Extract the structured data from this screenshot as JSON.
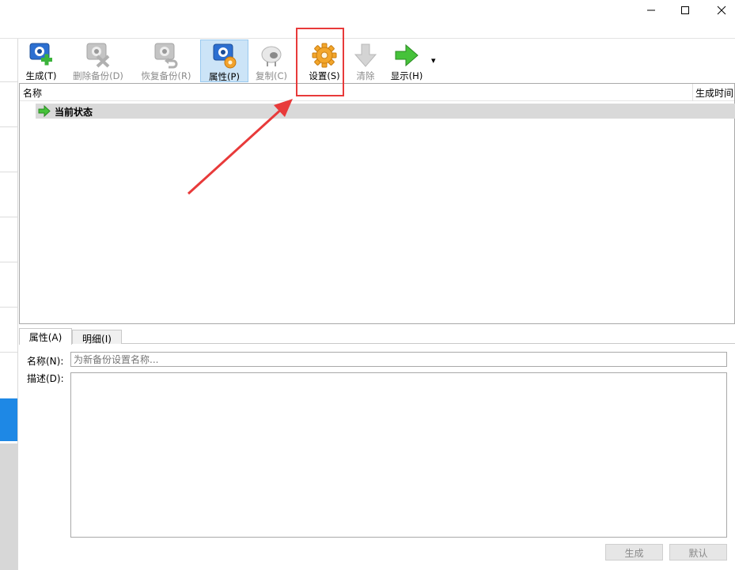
{
  "window_controls": {
    "minimize": "—",
    "maximize": "☐",
    "close": "✕"
  },
  "toolbar": {
    "items": [
      {
        "label": "生成(T)",
        "icon": "snapshot-create-icon",
        "enabled": true
      },
      {
        "label": "删除备份(D)",
        "icon": "snapshot-delete-icon",
        "enabled": false
      },
      {
        "label": "恢复备份(R)",
        "icon": "snapshot-restore-icon",
        "enabled": false
      },
      {
        "label": "属性(P)",
        "icon": "snapshot-properties-icon",
        "enabled": true,
        "active": true
      },
      {
        "label": "复制(C)",
        "icon": "clone-sheep-icon",
        "enabled": false
      },
      {
        "label": "设置(S)",
        "icon": "gear-icon",
        "enabled": true
      },
      {
        "label": "清除",
        "icon": "down-arrow-icon",
        "enabled": false
      },
      {
        "label": "显示(H)",
        "icon": "green-right-arrow-icon",
        "enabled": true
      }
    ],
    "more_dropdown": "▾"
  },
  "list": {
    "columns": [
      "名称",
      "生成时间"
    ],
    "rows": [
      {
        "name": "当前状态",
        "icon": "green-right-arrow-icon"
      }
    ]
  },
  "tabs": [
    {
      "label": "属性(A)",
      "active": true
    },
    {
      "label": "明细(I)",
      "active": false
    }
  ],
  "form": {
    "name_label": "名称(N):",
    "name_placeholder": "为新备份设置名称...",
    "desc_label": "描述(D):"
  },
  "buttons": {
    "create": "生成",
    "default": "默认"
  },
  "colors": {
    "highlight": "#e83a3a",
    "active_toolbar": "#cce4f7",
    "left_accent": "#1e88e5"
  }
}
